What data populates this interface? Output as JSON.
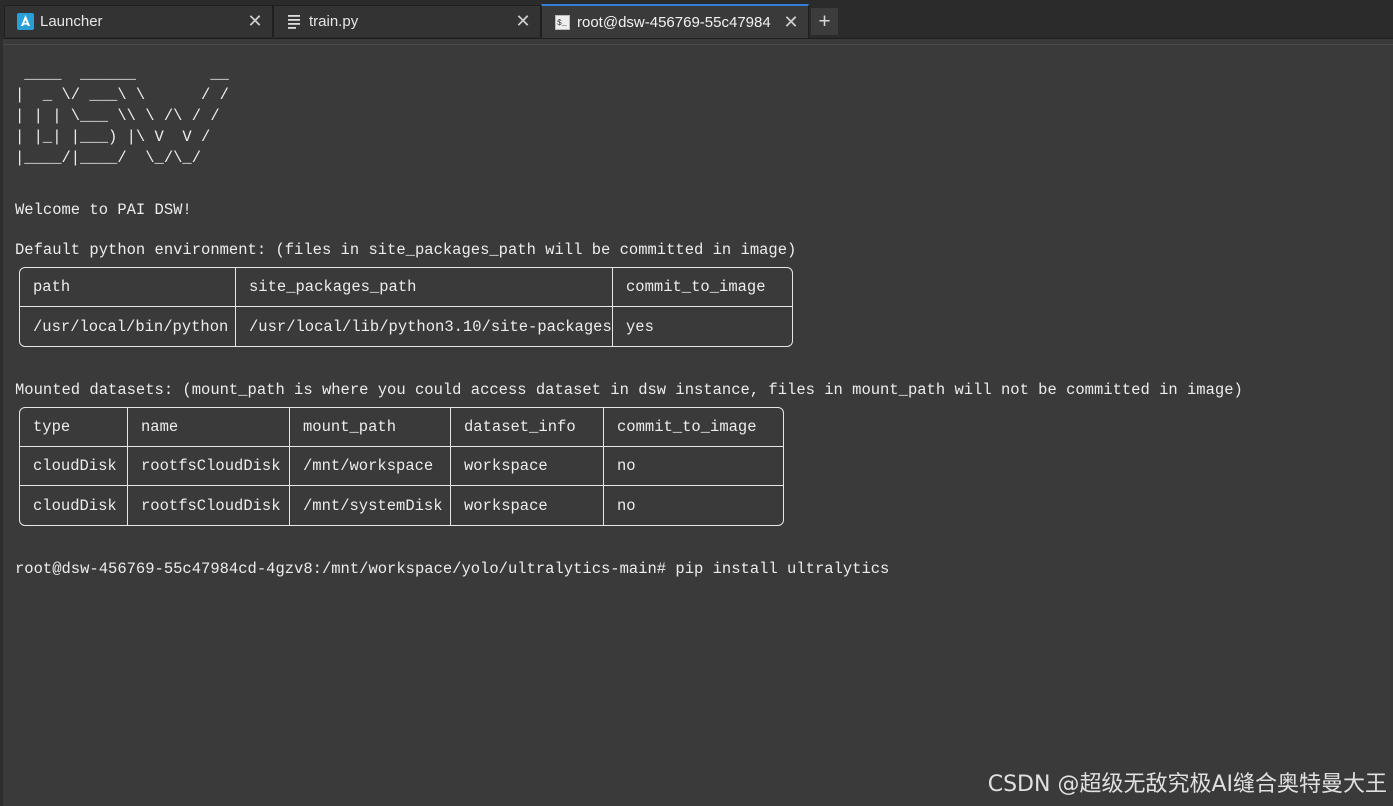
{
  "tabs": [
    {
      "label": "Launcher",
      "icon": "launcher-icon"
    },
    {
      "label": "train.py",
      "icon": "text-file-icon"
    },
    {
      "label": "root@dsw-456769-55c47984",
      "icon": "terminal-icon"
    }
  ],
  "close_glyph": "✕",
  "add_tab_glyph": "+",
  "terminal": {
    "banner": [
      " ____  ______        __",
      "|  _ \\/ ___\\ \\      / /",
      "| | | \\___ \\\\ \\ /\\ / /",
      "| |_| |___) |\\ V  V /",
      "|____/|____/  \\_/\\_/"
    ],
    "welcome": "Welcome to PAI DSW!",
    "env_intro": "Default python environment: (files in site_packages_path will be committed in image)",
    "env_table": {
      "headers": [
        "path",
        "site_packages_path",
        "commit_to_image"
      ],
      "rows": [
        [
          "/usr/local/bin/python",
          "/usr/local/lib/python3.10/site-packages",
          "yes"
        ]
      ]
    },
    "datasets_intro": "Mounted datasets: (mount_path is where you could access dataset in dsw instance, files in mount_path will not be committed in image)",
    "datasets_table": {
      "headers": [
        "type",
        "name",
        "mount_path",
        "dataset_info",
        "commit_to_image"
      ],
      "rows": [
        [
          "cloudDisk",
          "rootfsCloudDisk",
          "/mnt/workspace",
          "workspace",
          "no"
        ],
        [
          "cloudDisk",
          "rootfsCloudDisk",
          "/mnt/systemDisk",
          "workspace",
          "no"
        ]
      ]
    },
    "prompt": "root@dsw-456769-55c47984cd-4gzv8:/mnt/workspace/yolo/ultralytics-main#",
    "command": "pip install ultralytics"
  },
  "watermark": "CSDN @超级无敌究极AI缝合奥特曼大王",
  "colors": {
    "active_tab_accent": "#2f7ed8",
    "terminal_bg": "#3a3a3a",
    "tabbar_bg": "#2b2b2b"
  }
}
